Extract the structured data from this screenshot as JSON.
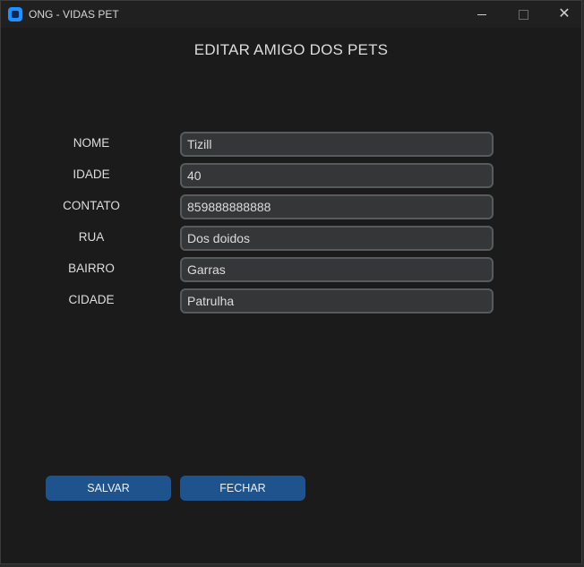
{
  "window": {
    "title": "ONG - VIDAS PET",
    "app_icon": "app-icon",
    "controls": {
      "minimize_icon": "minimize-icon",
      "maximize_icon": "maximize-icon",
      "close_glyph": "✕"
    }
  },
  "page": {
    "title": "EDITAR AMIGO DOS PETS"
  },
  "form": {
    "fields": [
      {
        "label": "NOME",
        "value": "Tizill"
      },
      {
        "label": "IDADE",
        "value": "40"
      },
      {
        "label": "CONTATO",
        "value": "859888888888"
      },
      {
        "label": "RUA",
        "value": "Dos doidos"
      },
      {
        "label": "BAIRRO",
        "value": "Garras"
      },
      {
        "label": "CIDADE",
        "value": "Patrulha"
      }
    ]
  },
  "actions": {
    "save_label": "SALVAR",
    "close_label": "FECHAR"
  },
  "colors": {
    "background": "#1b1b1c",
    "input_bg": "#343638",
    "input_border": "#565b5e",
    "button": "#1f538d",
    "app_icon": "#1e90ff"
  }
}
